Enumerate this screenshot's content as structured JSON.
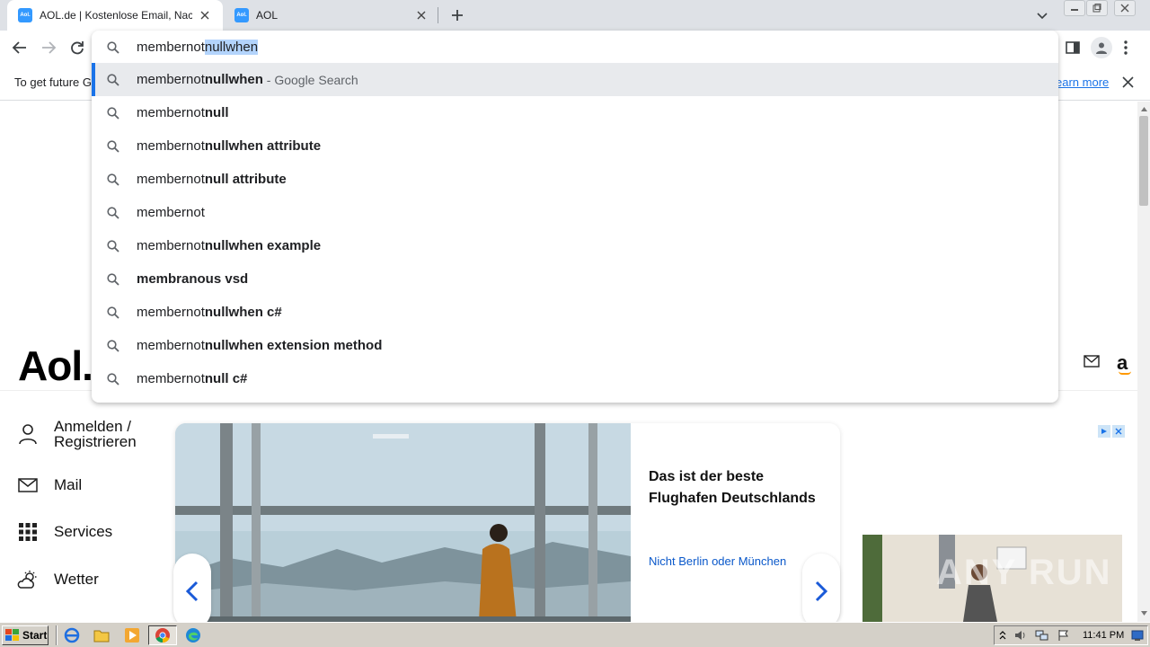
{
  "browser": {
    "tabs": [
      {
        "title": "AOL.de | Kostenlose Email, Nachrichten",
        "favicon": "Aol.",
        "active": true
      },
      {
        "title": "AOL",
        "favicon": "Aol.",
        "active": false
      }
    ],
    "new_tab_icon": "plus-icon",
    "omnibox": {
      "typed_prefix": "membernot",
      "autocomplete_selected": "nullwhen",
      "suggestions": [
        {
          "typed": "membernot",
          "rest": "nullwhen",
          "hint": " - Google Search"
        },
        {
          "typed": "membernot",
          "rest": "null",
          "hint": ""
        },
        {
          "typed": "membernot",
          "rest": "nullwhen attribute",
          "hint": ""
        },
        {
          "typed": "membernot",
          "rest": "null attribute",
          "hint": ""
        },
        {
          "typed": "membernot",
          "rest": "",
          "hint": ""
        },
        {
          "typed": "membernot",
          "rest": "nullwhen example",
          "hint": ""
        },
        {
          "typed": "",
          "rest": "membranous vsd",
          "hint": ""
        },
        {
          "typed": "membernot",
          "rest": "nullwhen c#",
          "hint": ""
        },
        {
          "typed": "membernot",
          "rest": "nullwhen extension method",
          "hint": ""
        },
        {
          "typed": "membernot",
          "rest": "null c#",
          "hint": ""
        }
      ]
    },
    "infobar": {
      "text_left": "To get future G",
      "link_right": "earn more"
    },
    "accent_color": "#1a73e8"
  },
  "page": {
    "logo": "Aol.",
    "nav": [
      {
        "label": "Anmelden / Registrieren",
        "icon": "user-icon"
      },
      {
        "label": "Mail",
        "icon": "mail-icon"
      },
      {
        "label": "Services",
        "icon": "grid-icon"
      },
      {
        "label": "Wetter",
        "icon": "weather-icon"
      }
    ],
    "card": {
      "title": "Das ist der beste Flughafen Deutschlands",
      "link": "Nicht Berlin oder München"
    },
    "watermark": "ANY RUN"
  },
  "taskbar": {
    "start_label": "Start",
    "clock": "11:41 PM"
  }
}
